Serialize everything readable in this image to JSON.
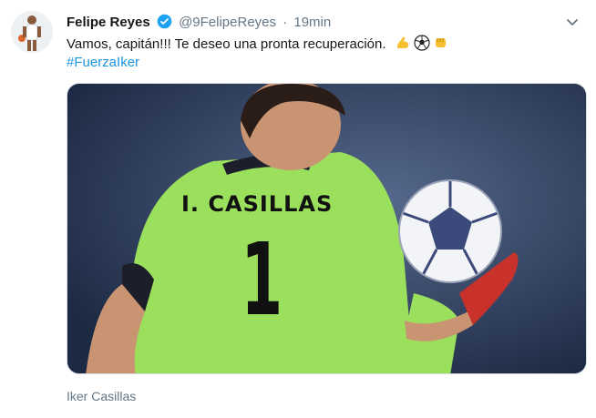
{
  "tweet": {
    "display_name": "Felipe Reyes",
    "handle": "@9FelipeReyes",
    "separator": "·",
    "time": "19min",
    "text": "Vamos, capitán!!! Te deseo una pronta recuperación.",
    "emojis": [
      "flexed-biceps-icon",
      "soccer-ball-icon",
      "fist-bump-icon"
    ],
    "hashtag": "#FuerzaIker",
    "media": {
      "jersey_name": "I. CASILLAS",
      "jersey_number": "1",
      "caption": "Iker Casillas"
    }
  },
  "colors": {
    "link": "#1b95e0",
    "secondary_text": "#657786",
    "verified": "#1da1f2",
    "jersey": "#9be05c"
  }
}
